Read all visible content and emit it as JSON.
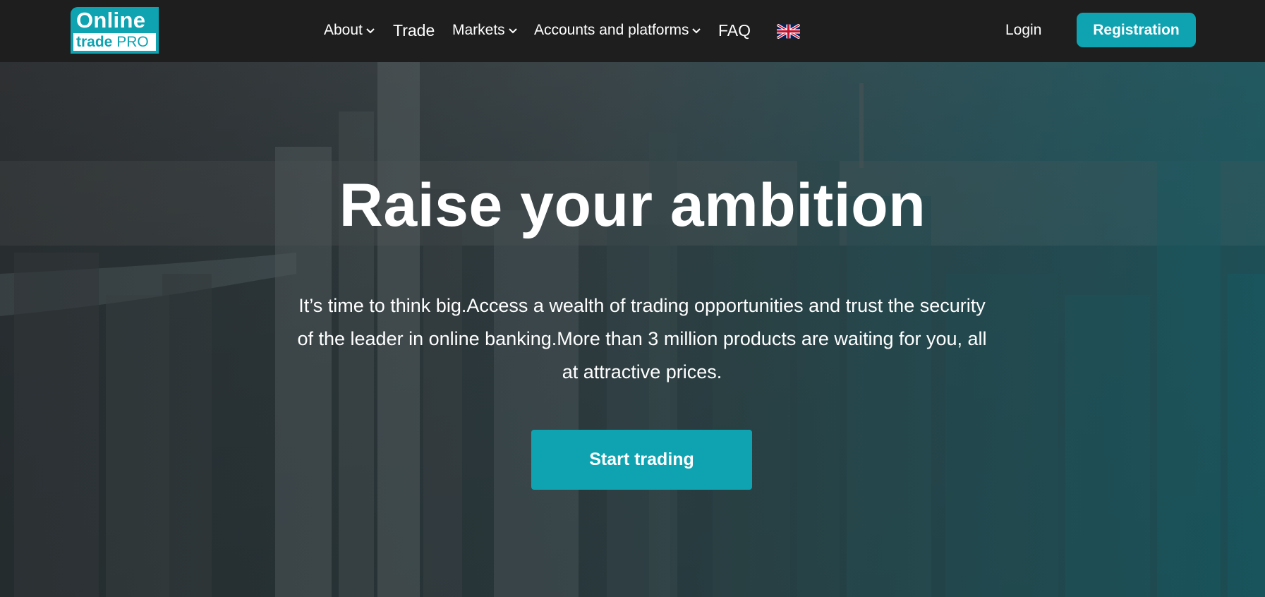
{
  "header": {
    "logo": {
      "top": "Online",
      "bottom_bold": "trade",
      "bottom_regular": " PRO"
    },
    "nav": [
      {
        "label": "About",
        "has_dropdown": true
      },
      {
        "label": "Trade",
        "has_dropdown": false
      },
      {
        "label": "Markets",
        "has_dropdown": true
      },
      {
        "label": "Accounts and platforms",
        "has_dropdown": true
      },
      {
        "label": "FAQ",
        "has_dropdown": false
      }
    ],
    "language_icon": "uk-flag-icon",
    "login_label": "Login",
    "register_label": "Registration"
  },
  "hero": {
    "title": "Raise your ambition",
    "text": "It’s time to think big.Access a wealth of trading opportunities and trust the security of the leader in online banking.More than 3 million products are waiting for you, all at attractive prices.",
    "cta_label": "Start trading"
  },
  "colors": {
    "accent": "#0fa3b1",
    "header_bg": "#1e1e1e",
    "text": "#ffffff"
  }
}
